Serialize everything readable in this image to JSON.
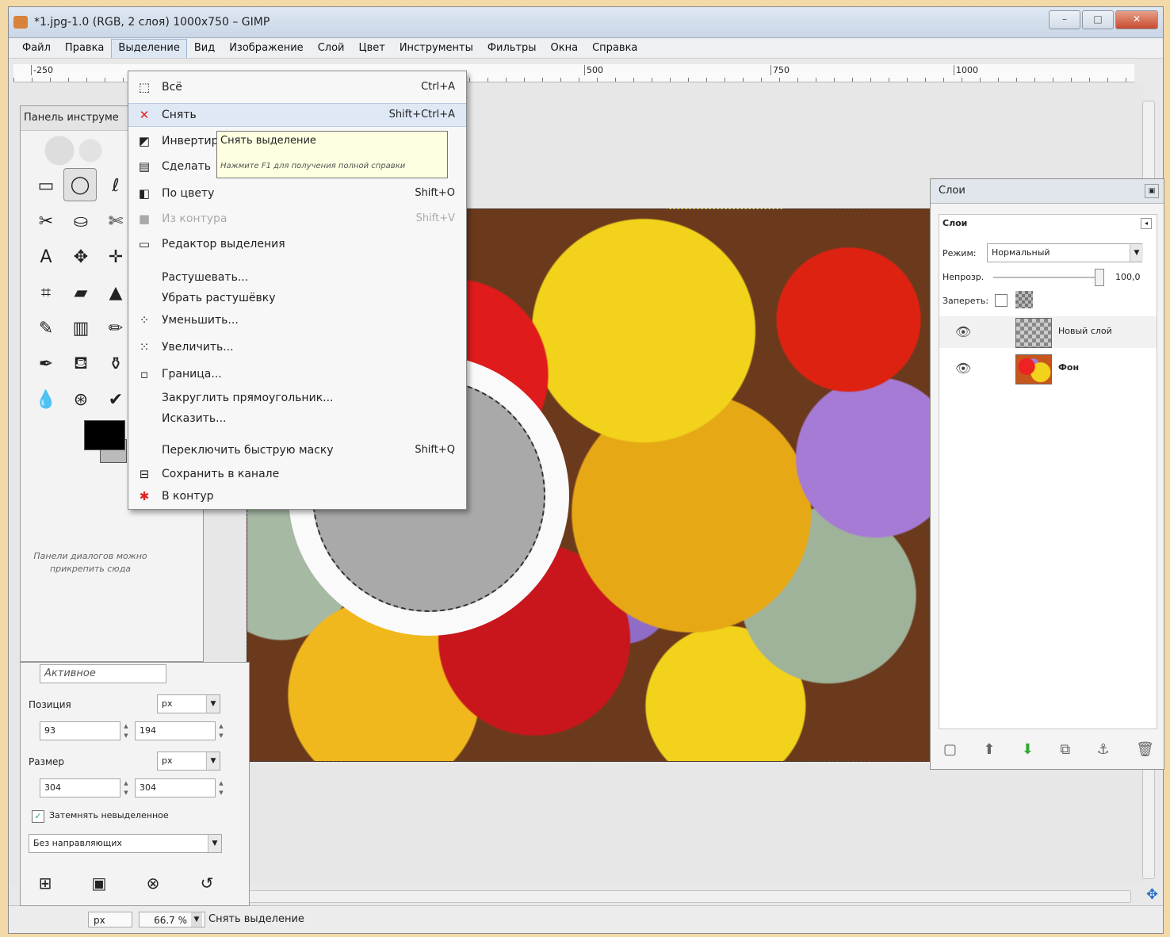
{
  "window": {
    "title": "*1.jpg-1.0 (RGB, 2 слоя) 1000x750 – GIMP",
    "minimize": "–",
    "maximize": "□",
    "close": "✕"
  },
  "menubar": [
    "Файл",
    "Правка",
    "Выделение",
    "Вид",
    "Изображение",
    "Слой",
    "Цвет",
    "Инструменты",
    "Фильтры",
    "Окна",
    "Справка"
  ],
  "ruler": {
    "marks": [
      "-250",
      "500",
      "750",
      "1000"
    ]
  },
  "select_menu": {
    "items": [
      {
        "label": "Всё",
        "shortcut": "Ctrl+A",
        "icon": "select-all-icon",
        "glyph": "⬚",
        "disabled": false
      },
      {
        "label": "Снять",
        "shortcut": "Shift+Ctrl+A",
        "icon": "select-none-icon",
        "glyph": "✕",
        "disabled": false,
        "highlighted": true
      },
      {
        "label": "Инвертир",
        "shortcut": "",
        "icon": "invert-selection-icon",
        "glyph": "◩",
        "disabled": false
      },
      {
        "label": "Сделать",
        "shortcut": "",
        "icon": "float-selection-icon",
        "glyph": "▤",
        "disabled": false
      },
      {
        "label": "По цвету",
        "shortcut": "Shift+O",
        "icon": "select-by-color-icon",
        "glyph": "◧",
        "disabled": false
      },
      {
        "label": "Из контура",
        "shortcut": "Shift+V",
        "icon": "from-path-icon",
        "glyph": "■",
        "disabled": true
      },
      {
        "label": "Редактор выделения",
        "shortcut": "",
        "icon": "selection-editor-icon",
        "glyph": "▭",
        "disabled": false
      },
      {
        "label": "Растушевать...",
        "shortcut": "",
        "icon": "",
        "glyph": "",
        "disabled": false
      },
      {
        "label": "Убрать растушёвку",
        "shortcut": "",
        "icon": "",
        "glyph": "",
        "disabled": false
      },
      {
        "label": "Уменьшить...",
        "shortcut": "",
        "icon": "shrink-icon",
        "glyph": "⁘",
        "disabled": false
      },
      {
        "label": "Увеличить...",
        "shortcut": "",
        "icon": "grow-icon",
        "glyph": "⁙",
        "disabled": false
      },
      {
        "label": "Граница...",
        "shortcut": "",
        "icon": "border-icon",
        "glyph": "▫",
        "disabled": false
      },
      {
        "label": "Закруглить прямоугольник...",
        "shortcut": "",
        "icon": "",
        "glyph": "",
        "disabled": false
      },
      {
        "label": "Исказить...",
        "shortcut": "",
        "icon": "",
        "glyph": "",
        "disabled": false
      },
      {
        "label": "Переключить быструю маску",
        "shortcut": "Shift+Q",
        "icon": "",
        "glyph": "",
        "disabled": false
      },
      {
        "label": "Сохранить в канале",
        "shortcut": "",
        "icon": "save-to-channel-icon",
        "glyph": "⊟",
        "disabled": false
      },
      {
        "label": "В контур",
        "shortcut": "",
        "icon": "to-path-icon",
        "glyph": "✱",
        "disabled": false
      }
    ]
  },
  "tooltip": {
    "title": "Снять выделение",
    "hint": "Нажмите F1 для получения полной справки"
  },
  "toolbox": {
    "title": "Панель инструме",
    "hint": "Панели диалогов можно прикрепить сюда",
    "tools": [
      {
        "name": "rect-select-icon",
        "glyph": "▭"
      },
      {
        "name": "ellipse-select-icon",
        "glyph": "◯",
        "selected": true
      },
      {
        "name": "free-select-icon",
        "glyph": "ℓ"
      },
      {
        "name": "fuzzy-select-icon",
        "glyph": "✂"
      },
      {
        "name": "by-color-select-icon",
        "glyph": "⛀"
      },
      {
        "name": "scissors-select-icon",
        "glyph": "✄"
      },
      {
        "name": "paths-icon",
        "glyph": "A"
      },
      {
        "name": "move-icon",
        "glyph": "✥"
      },
      {
        "name": "align-icon",
        "glyph": "✛"
      },
      {
        "name": "crop-icon",
        "glyph": "⌗"
      },
      {
        "name": "rotate-icon",
        "glyph": "▰"
      },
      {
        "name": "perspective-icon",
        "glyph": "▲"
      },
      {
        "name": "text-icon",
        "glyph": "✎"
      },
      {
        "name": "blend-icon",
        "glyph": "▥"
      },
      {
        "name": "pencil-icon",
        "glyph": "✏"
      },
      {
        "name": "airbrush-icon",
        "glyph": "✒"
      },
      {
        "name": "ink-icon",
        "glyph": "⛾"
      },
      {
        "name": "clone-icon",
        "glyph": "⚱"
      },
      {
        "name": "dodge-icon",
        "glyph": "💧"
      },
      {
        "name": "smudge-icon",
        "glyph": "⊛"
      },
      {
        "name": "color-picker-icon",
        "glyph": "✔"
      }
    ]
  },
  "tool_options": {
    "mode_value": "Активное",
    "position_label": "Позиция",
    "position_unit": "px",
    "pos_x": "93",
    "pos_y": "194",
    "size_label": "Размер",
    "size_unit": "px",
    "size_w": "304",
    "size_h": "304",
    "highlight_label": "Затемнять невыделенное",
    "highlight_checked": "✓",
    "guides_value": "Без направляющих"
  },
  "layers_dock": {
    "title": "Слои",
    "tab": "Слои",
    "mode_label": "Режим:",
    "mode_value": "Нормальный",
    "opacity_label": "Непрозр.",
    "opacity_value": "100,0",
    "lock_label": "Запереть:",
    "layers": [
      {
        "name": "Новый слой",
        "visible": "👁"
      },
      {
        "name": "Фон",
        "visible": "👁"
      }
    ]
  },
  "statusbar": {
    "unit": "px",
    "zoom": "66.7 %",
    "message": "Снять выделение"
  }
}
